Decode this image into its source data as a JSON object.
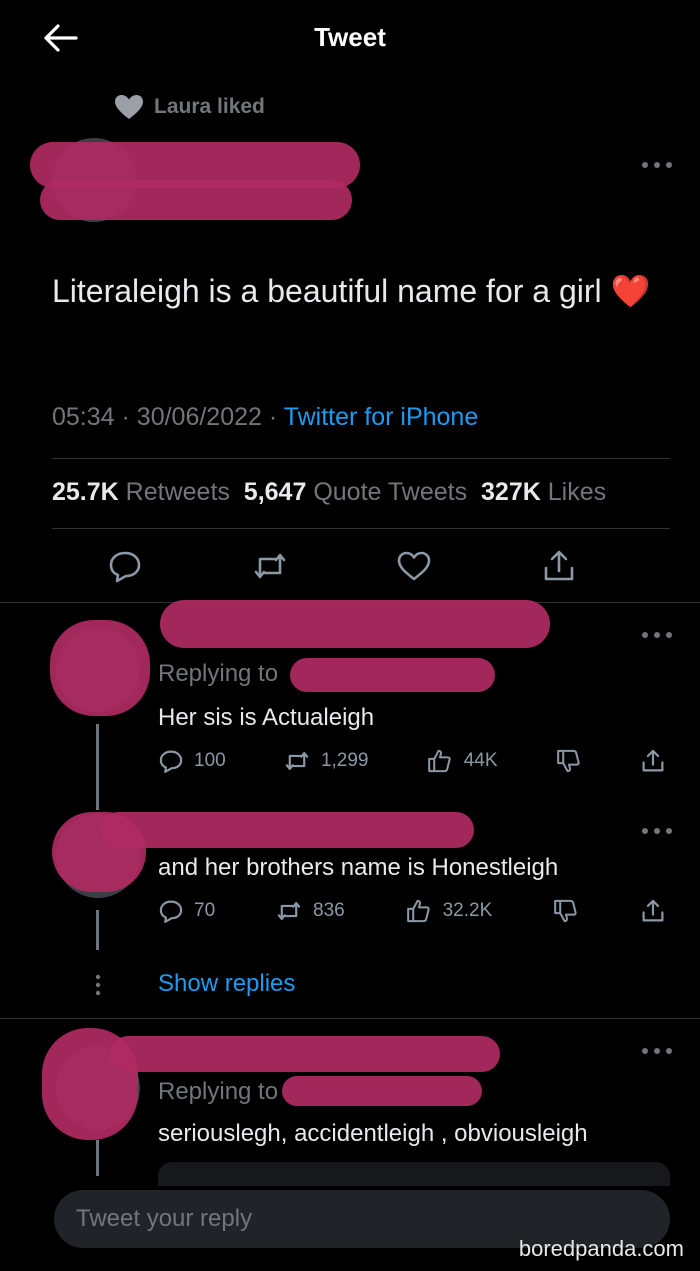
{
  "header": {
    "title": "Tweet"
  },
  "social_context": {
    "text": "Laura liked"
  },
  "tweet": {
    "text": "Literaleigh is a beautiful name for a girl",
    "emoji": "❤️",
    "time": "05:34",
    "date": "30/06/2022",
    "source": "Twitter for iPhone",
    "retweets_count": "25.7K",
    "retweets_label": "Retweets",
    "quotes_count": "5,647",
    "quotes_label": "Quote Tweets",
    "likes_count": "327K",
    "likes_label": "Likes"
  },
  "replies": [
    {
      "replying_to": "Replying to",
      "text": "Her sis is Actualeigh",
      "comments": "100",
      "retweets": "1,299",
      "likes": "44K"
    },
    {
      "text": "and her brothers name is Honestleigh",
      "comments": "70",
      "retweets": "836",
      "likes": "32.2K"
    },
    {
      "replying_to": "Replying to",
      "text": "seriouslegh, accidentleigh , obviousleigh"
    }
  ],
  "show_replies": "Show replies",
  "compose": {
    "placeholder": "Tweet your reply"
  },
  "watermark": "boredpanda.com",
  "colors": {
    "accent": "#1d9bf0",
    "background": "#000000",
    "redaction": "#b02a62"
  }
}
